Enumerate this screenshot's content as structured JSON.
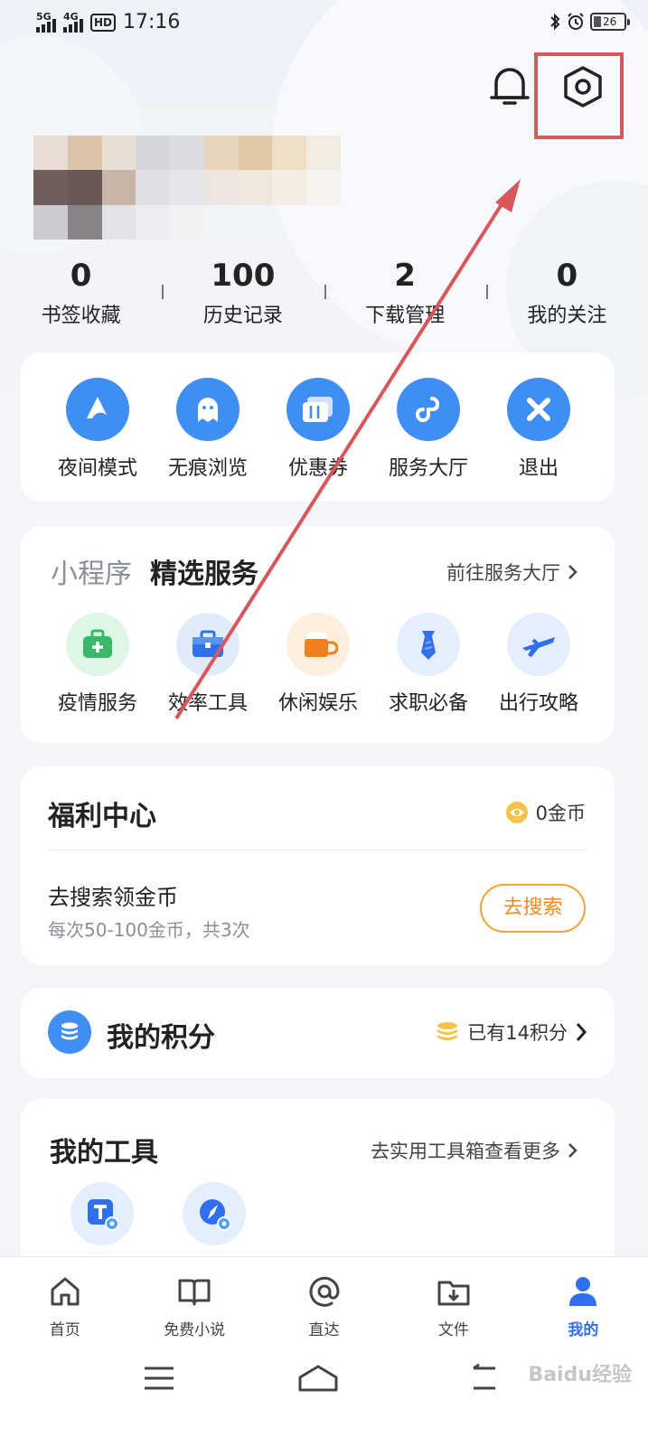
{
  "status_bar": {
    "network1": "5G",
    "network2": "4G",
    "hd": "HD",
    "time": "17:16",
    "battery": "26"
  },
  "header": {
    "bell_icon": "bell-icon",
    "settings_icon": "settings-hexagon-icon"
  },
  "stats": [
    {
      "value": "0",
      "label": "书签收藏"
    },
    {
      "value": "100",
      "label": "历史记录"
    },
    {
      "value": "2",
      "label": "下载管理"
    },
    {
      "value": "0",
      "label": "我的关注"
    }
  ],
  "quick_actions": [
    {
      "label": "夜间模式",
      "icon": "night-mode-icon"
    },
    {
      "label": "无痕浏览",
      "icon": "ghost-icon"
    },
    {
      "label": "优惠券",
      "icon": "coupon-icon"
    },
    {
      "label": "服务大厅",
      "icon": "link-icon"
    },
    {
      "label": "退出",
      "icon": "close-icon"
    }
  ],
  "services": {
    "tab_mini": "小程序",
    "tab_selected": "精选服务",
    "link": "前往服务大厅",
    "items": [
      {
        "label": "疫情服务",
        "icon": "medical-kit-icon",
        "bg": "#dff5e6"
      },
      {
        "label": "效率工具",
        "icon": "toolbox-icon",
        "bg": "#e1ecfb"
      },
      {
        "label": "休闲娱乐",
        "icon": "cup-icon",
        "bg": "#fdeedd"
      },
      {
        "label": "求职必备",
        "icon": "tie-icon",
        "bg": "#e4eefc"
      },
      {
        "label": "出行攻略",
        "icon": "plane-icon",
        "bg": "#e4eefc"
      }
    ]
  },
  "welfare": {
    "title": "福利中心",
    "coins": "0金币",
    "task_title": "去搜索领金币",
    "task_sub": "每次50-100金币，共3次",
    "button": "去搜索"
  },
  "points": {
    "title": "我的积分",
    "summary": "已有14积分"
  },
  "tools": {
    "title": "我的工具",
    "link": "去实用工具箱查看更多"
  },
  "bottom_nav": [
    {
      "label": "首页",
      "icon": "home-icon"
    },
    {
      "label": "免费小说",
      "icon": "book-icon"
    },
    {
      "label": "直达",
      "icon": "at-icon"
    },
    {
      "label": "文件",
      "icon": "folder-download-icon"
    },
    {
      "label": "我的",
      "icon": "user-icon",
      "active": true
    }
  ],
  "watermark": "Baidu经验",
  "colors": {
    "accent": "#3f8ef4",
    "active_nav": "#2f6ff0",
    "orange": "#f08a1c",
    "annotation": "#d8575a"
  }
}
